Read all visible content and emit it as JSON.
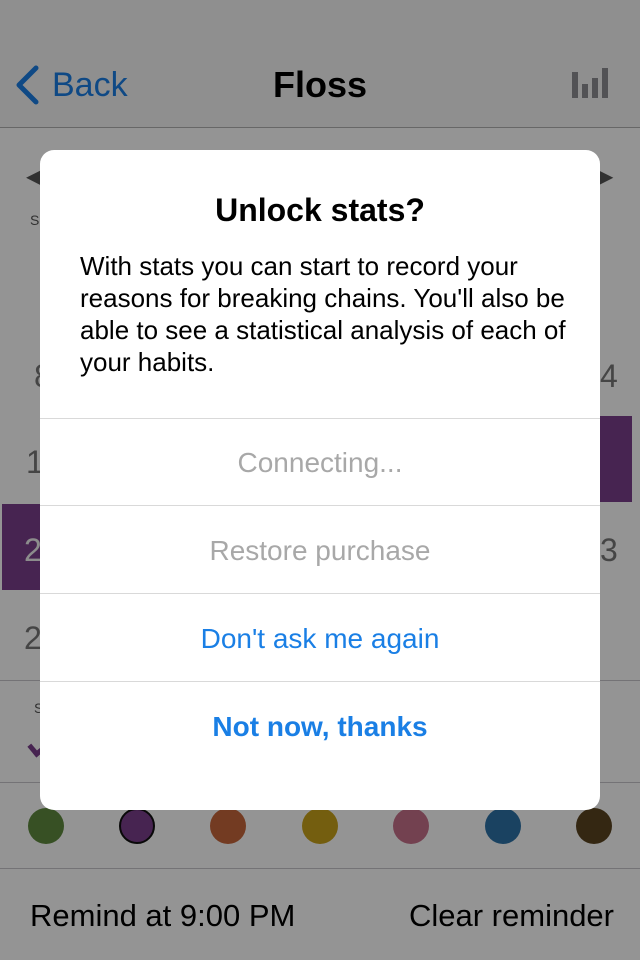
{
  "nav": {
    "back_label": "Back",
    "title": "Floss",
    "stats_icon": "bar-chart-icon"
  },
  "background": {
    "calendar_partial": [
      "8",
      "1",
      "2",
      "2",
      "4",
      "3"
    ],
    "accent_color": "#7b3f8c"
  },
  "colors": {
    "swatches": [
      "#5f8a3e",
      "#7b3f8c",
      "#c7673c",
      "#c9a21b",
      "#c7718a",
      "#2e73a8",
      "#5b4420"
    ],
    "selected_index": 1
  },
  "reminder": {
    "remind_label": "Remind at 9:00 PM",
    "clear_label": "Clear reminder"
  },
  "alert": {
    "title": "Unlock stats?",
    "message": "With stats you can start to record your reasons for breaking chains. You'll also be able to see a statistical analysis of each of your habits.",
    "buttons": {
      "connecting": "Connecting...",
      "restore": "Restore purchase",
      "dont_ask": "Don't ask me again",
      "not_now": "Not now, thanks"
    }
  }
}
